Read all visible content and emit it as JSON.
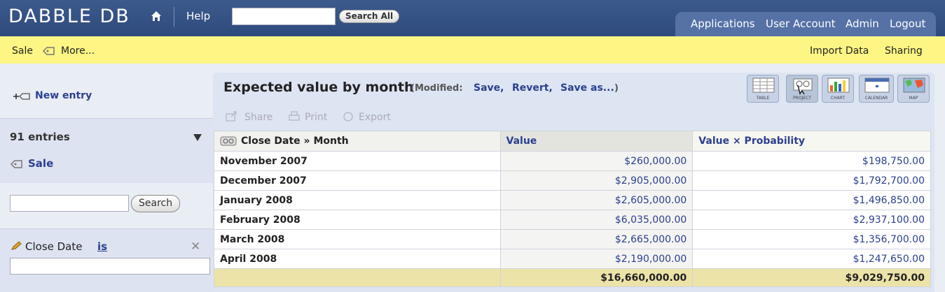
{
  "app": {
    "title": "DABBLE DB"
  },
  "topnav": {
    "help": "Help",
    "search_value": "",
    "search_button": "Search All",
    "right_links": [
      "Applications",
      "User Account",
      "Admin",
      "Logout"
    ]
  },
  "toolbar": {
    "sale": "Sale",
    "more": "More...",
    "import": "Import Data",
    "sharing": "Sharing"
  },
  "sidebar": {
    "new_entry": "New entry",
    "entries": "91 entries",
    "category": "Sale",
    "search_value": "",
    "search_button": "Search",
    "filter": {
      "field": "Close Date",
      "operator": "is",
      "value": ""
    }
  },
  "view": {
    "title": "Expected value by month",
    "modified_label": "(Modified:",
    "save": "Save,",
    "revert": "Revert,",
    "save_as": "Save as...",
    "close_paren": ")",
    "actions": [
      "Share",
      "Print",
      "Export"
    ],
    "view_types": [
      "TABLE",
      "PROJECT",
      "CHART",
      "CALENDAR",
      "MAP"
    ]
  },
  "table": {
    "headers": [
      "Close Date » Month",
      "Value",
      "Value × Probability"
    ],
    "rows": [
      [
        "November 2007",
        "$260,000.00",
        "$198,750.00"
      ],
      [
        "December 2007",
        "$2,905,000.00",
        "$1,792,700.00"
      ],
      [
        "January 2008",
        "$2,605,000.00",
        "$1,496,850.00"
      ],
      [
        "February 2008",
        "$6,035,000.00",
        "$2,937,100.00"
      ],
      [
        "March 2008",
        "$2,665,000.00",
        "$1,356,700.00"
      ],
      [
        "April 2008",
        "$2,190,000.00",
        "$1,247,650.00"
      ]
    ],
    "totals": [
      "",
      "$16,660,000.00",
      "$9,029,750.00"
    ]
  }
}
